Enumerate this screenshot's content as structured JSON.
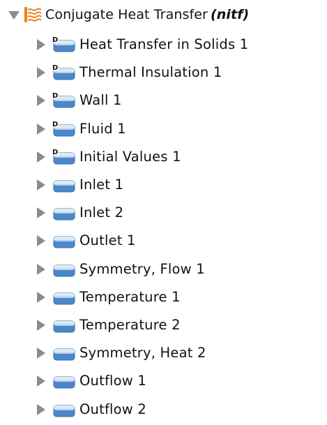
{
  "tree": {
    "root": {
      "label": "Conjugate Heat Transfer",
      "tag": "(nitf)",
      "icon": "heat-transfer-physics-icon",
      "expanded": true
    },
    "items": [
      {
        "label": "Heat Transfer in Solids 1",
        "icon": "default-node-icon",
        "default": true
      },
      {
        "label": "Thermal Insulation 1",
        "icon": "default-node-icon",
        "default": true
      },
      {
        "label": "Wall 1",
        "icon": "default-node-icon",
        "default": true
      },
      {
        "label": "Fluid 1",
        "icon": "default-node-icon",
        "default": true
      },
      {
        "label": "Initial Values 1",
        "icon": "default-node-icon",
        "default": true
      },
      {
        "label": "Inlet 1",
        "icon": "boundary-node-icon",
        "default": false
      },
      {
        "label": "Inlet 2",
        "icon": "boundary-node-icon",
        "default": false
      },
      {
        "label": "Outlet 1",
        "icon": "boundary-node-icon",
        "default": false
      },
      {
        "label": "Symmetry, Flow 1",
        "icon": "boundary-node-icon",
        "default": false
      },
      {
        "label": "Temperature 1",
        "icon": "boundary-node-icon",
        "default": false
      },
      {
        "label": "Temperature 2",
        "icon": "boundary-node-icon",
        "default": false
      },
      {
        "label": "Symmetry, Heat 2",
        "icon": "boundary-node-icon",
        "default": false
      },
      {
        "label": "Outflow 1",
        "icon": "boundary-node-icon",
        "default": false
      },
      {
        "label": "Outflow 2",
        "icon": "boundary-node-icon",
        "default": false
      }
    ],
    "colors": {
      "toggle": "#8c8c8c",
      "icon_blue": "#4a89c8",
      "icon_light": "#dce9f7",
      "physics_orange": "#e7821f"
    }
  }
}
